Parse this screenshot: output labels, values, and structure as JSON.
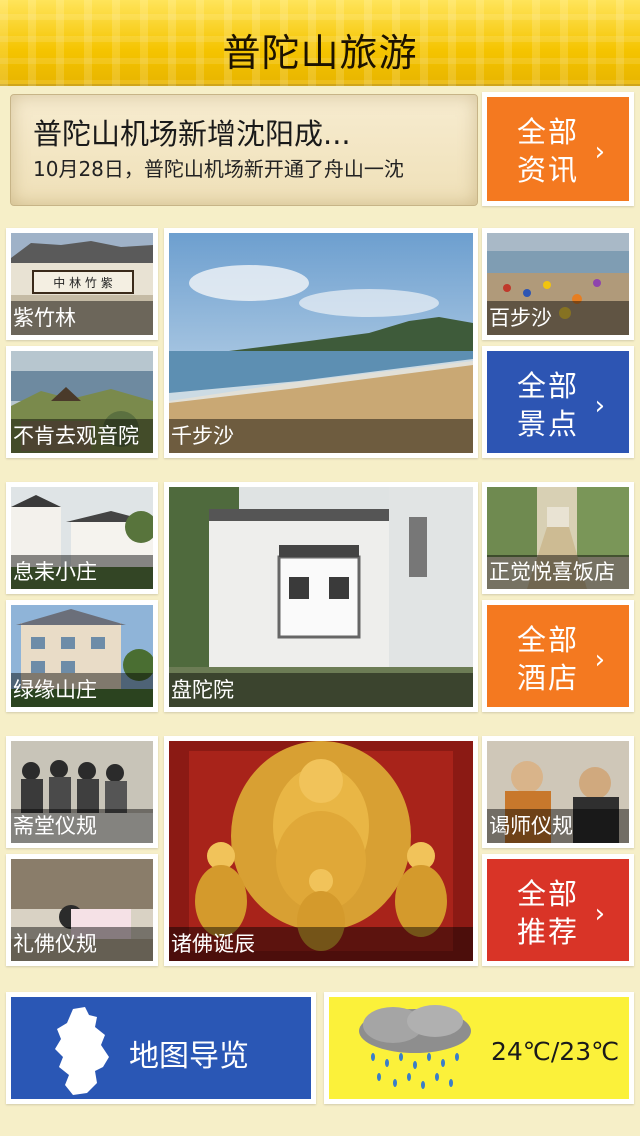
{
  "app": {
    "title": "普陀山旅游"
  },
  "news": {
    "headline": "普陀山机场新增沈阳成...",
    "summary": "10月28日，普陀山机场新开通了舟山一沈"
  },
  "sections": {
    "news_more": {
      "line1": "全部",
      "line2": "资讯",
      "color": "#f47920"
    },
    "scenic": {
      "tiles": [
        "紫竹林",
        "不肯去观音院",
        "千步沙",
        "百步沙"
      ],
      "more": {
        "line1": "全部",
        "line2": "景点",
        "color": "#2d55b3"
      }
    },
    "hotels": {
      "tiles": [
        "息耒小庄",
        "绿缘山庄",
        "盘陀院",
        "正觉悦喜饭店"
      ],
      "more": {
        "line1": "全部",
        "line2": "酒店",
        "color": "#f47920"
      }
    },
    "recommend": {
      "tiles": [
        "斋堂仪规",
        "礼佛仪规",
        "诸佛诞辰",
        "谒师仪规"
      ],
      "more": {
        "line1": "全部",
        "line2": "推荐",
        "color": "#d93427"
      }
    }
  },
  "bottom": {
    "map_label": "地图导览",
    "weather_temp": "24℃/23℃"
  },
  "icons": {
    "chevron": "chevron-right-icon",
    "map": "island-map-icon",
    "weather": "rain-cloud-icon"
  }
}
